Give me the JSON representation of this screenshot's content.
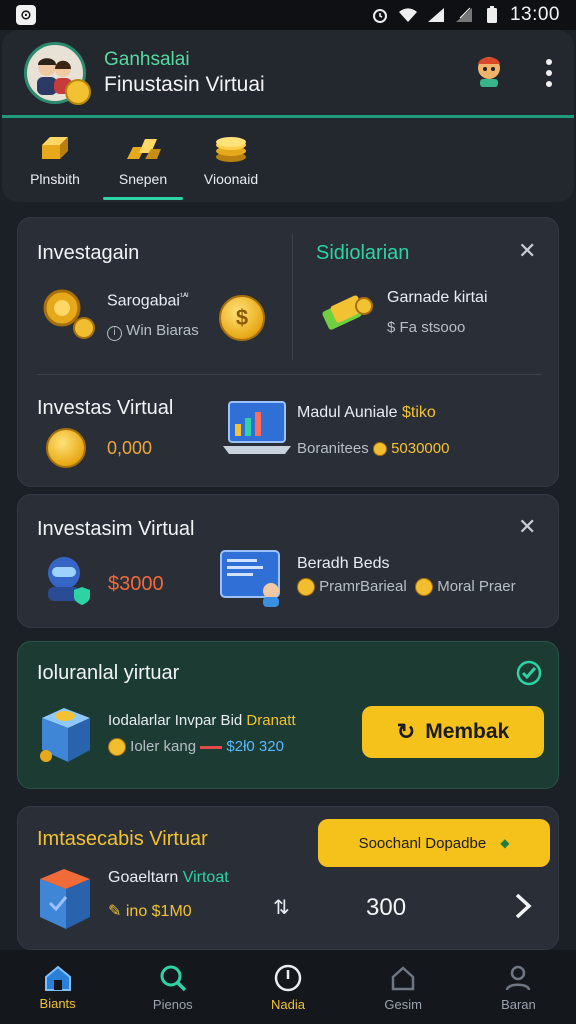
{
  "status_bar": {
    "time": "13:00"
  },
  "header": {
    "subtitle": "Ganhsalai",
    "title": "Finustasin Virtuai"
  },
  "tabs": [
    {
      "label": "Plnsbith",
      "icon": "gold-bar-icon"
    },
    {
      "label": "Snepen",
      "icon": "gold-ingots-icon",
      "active": true
    },
    {
      "label": "Vioonaid",
      "icon": "coin-stack-icon"
    }
  ],
  "card1": {
    "title": "Investagain",
    "right_title": "Sidiolarian",
    "item1": {
      "title": "Sarogabai",
      "badge": "¹ᴬᴵ",
      "sub": "Win Biaras"
    },
    "item2": {
      "title": "Garnade kirtai",
      "sub": "Fa stsooo"
    },
    "section_title": "Investas Virtual",
    "value": "0,000",
    "promo_title": "Madul Auniale",
    "promo_highlight": "$tiko",
    "promo_sub": "Boranitees",
    "promo_value": "5030000"
  },
  "card2": {
    "title": "Investasim Virtual",
    "value": "$3000",
    "item_title": "Beradh Beds",
    "item_sub1": "PramrBarieal",
    "item_sub2": "Moral Praer"
  },
  "card3": {
    "title": "Ioluranlal yirtuar",
    "line1_prefix": "Iodalarlar Invpar Bid",
    "line1_highlight": "Dranatt",
    "line2_label": "Ioler kang",
    "line2_value": "$2ł0 320",
    "button_label": "Membak"
  },
  "card4": {
    "title": "Imtasecabis Virtuar",
    "button_label": "Soochanl Dopadbe",
    "item_title": "Goaeltarn",
    "item_highlight": "Virtoat",
    "item_sub": "ino $1M0",
    "value": "300"
  },
  "nav": [
    {
      "label": "Biants",
      "icon": "home-icon",
      "active": true
    },
    {
      "label": "Pienos",
      "icon": "search-icon"
    },
    {
      "label": "Nadia",
      "icon": "clock-icon"
    },
    {
      "label": "Gesim",
      "icon": "bag-icon"
    },
    {
      "label": "Baran",
      "icon": "profile-icon"
    }
  ],
  "colors": {
    "accent_green": "#2dd3a4",
    "gold": "#f2c233",
    "button_yellow": "#f5c21b",
    "background": "#1b1f26"
  }
}
